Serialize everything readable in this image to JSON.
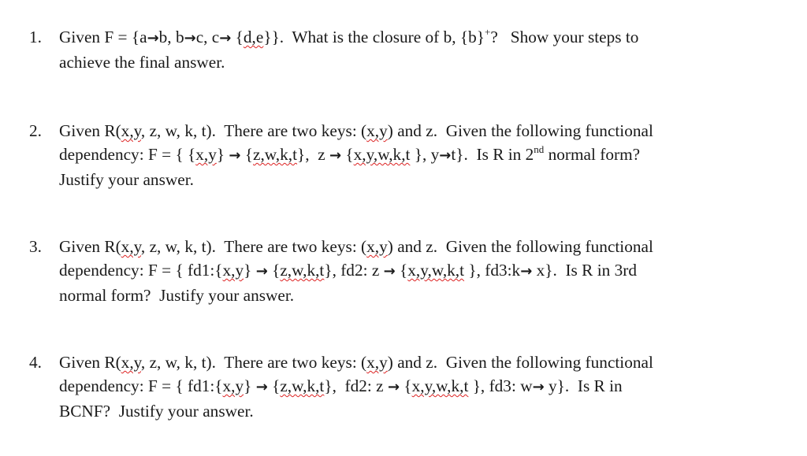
{
  "document": {
    "questions": [
      {
        "number": "1.",
        "lines": [
          [
            {
              "t": "Given F = {a"
            },
            {
              "arrow": "→"
            },
            {
              "t": "b, b"
            },
            {
              "arrow": "→"
            },
            {
              "t": "c, c"
            },
            {
              "arrow": "→"
            },
            {
              "t": " {"
            },
            {
              "t": "d,e",
              "sq": true
            },
            {
              "t": "}}.  What is the closure of b, {b}"
            },
            {
              "sup": "+"
            },
            {
              "t": "?   Show your steps to"
            }
          ],
          [
            {
              "t": "achieve the final answer."
            }
          ]
        ]
      },
      {
        "number": "2.",
        "lines": [
          [
            {
              "t": "Given R("
            },
            {
              "t": "x,y",
              "sq": true
            },
            {
              "t": ", z, w, k, t).  There are two keys: ("
            },
            {
              "t": "x,y",
              "sq": true
            },
            {
              "t": ") and z.  Given the following functional"
            }
          ],
          [
            {
              "t": "dependency: F = { {"
            },
            {
              "t": "x,y",
              "sq": true
            },
            {
              "t": "} "
            },
            {
              "arrow": "→"
            },
            {
              "t": " {"
            },
            {
              "t": "z,w,k,t",
              "sq": true
            },
            {
              "t": "},  z "
            },
            {
              "arrow": "→"
            },
            {
              "t": " {"
            },
            {
              "t": "x,y,w,k,t",
              "sq": true
            },
            {
              "t": " }, y"
            },
            {
              "arrow": "→"
            },
            {
              "t": "t}.  Is R in 2"
            },
            {
              "sup": "nd"
            },
            {
              "t": " normal form?"
            }
          ],
          [
            {
              "t": "Justify your answer."
            }
          ]
        ]
      },
      {
        "number": "3.",
        "lines": [
          [
            {
              "t": "Given R("
            },
            {
              "t": "x,y",
              "sq": true
            },
            {
              "t": ", z, w, k, t).  There are two keys: ("
            },
            {
              "t": "x,y",
              "sq": true
            },
            {
              "t": ") and z.  Given the following functional"
            }
          ],
          [
            {
              "t": "dependency: F = { fd1:{"
            },
            {
              "t": "x,y",
              "sq": true
            },
            {
              "t": "} "
            },
            {
              "arrow": "→"
            },
            {
              "t": " {"
            },
            {
              "t": "z,w,k,t",
              "sq": true
            },
            {
              "t": "}, fd2: z "
            },
            {
              "arrow": "→"
            },
            {
              "t": " {"
            },
            {
              "t": "x,y,w,k,t",
              "sq": true
            },
            {
              "t": " }, fd3:k"
            },
            {
              "arrow": "→"
            },
            {
              "t": " x}.  Is R in 3rd"
            }
          ],
          [
            {
              "t": "normal form?  Justify your answer."
            }
          ]
        ]
      },
      {
        "number": "4.",
        "lines": [
          [
            {
              "t": "Given R("
            },
            {
              "t": "x,y",
              "sq": true
            },
            {
              "t": ", z, w, k, t).  There are two keys: ("
            },
            {
              "t": "x,y",
              "sq": true
            },
            {
              "t": ") and z.  Given the following functional"
            }
          ],
          [
            {
              "t": "dependency: F = { fd1:{"
            },
            {
              "t": "x,y",
              "sq": true
            },
            {
              "t": "} "
            },
            {
              "arrow": "→"
            },
            {
              "t": " {"
            },
            {
              "t": "z,w,k,t",
              "sq": true
            },
            {
              "t": "},  fd2: z "
            },
            {
              "arrow": "→"
            },
            {
              "t": " {"
            },
            {
              "t": "x,y,w,k,t",
              "sq": true
            },
            {
              "t": " }, fd3: w"
            },
            {
              "arrow": "→"
            },
            {
              "t": " y}.  Is R in"
            }
          ],
          [
            {
              "t": "BCNF?  Justify your answer."
            }
          ]
        ]
      }
    ]
  }
}
